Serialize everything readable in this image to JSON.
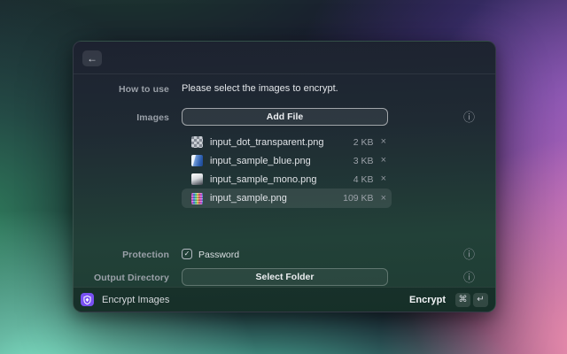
{
  "window": {
    "header": {
      "back_icon": "←"
    },
    "form": {
      "how_to_use": {
        "label": "How to use",
        "value": "Please select the images to encrypt."
      },
      "images": {
        "label": "Images",
        "add_file_label": "Add File",
        "files": [
          {
            "name": "input_dot_transparent.png",
            "size": "2 KB",
            "thumb": "checkerboard-transparent",
            "selected": false
          },
          {
            "name": "input_sample_blue.png",
            "size": "3 KB",
            "thumb": "blue-image",
            "selected": false
          },
          {
            "name": "input_sample_mono.png",
            "size": "4 KB",
            "thumb": "mono-gradient",
            "selected": false
          },
          {
            "name": "input_sample.png",
            "size": "109 KB",
            "thumb": "color-noise",
            "selected": true
          }
        ]
      },
      "protection": {
        "label": "Protection",
        "checkbox_label": "Password",
        "checked": true
      },
      "output_directory": {
        "label": "Output Directory",
        "button_label": "Select Folder"
      }
    },
    "footer": {
      "app_title": "Encrypt Images",
      "action_label": "Encrypt",
      "shortcut_keys": [
        "⌘",
        "↵"
      ]
    },
    "icons": {
      "remove": "×",
      "info": "ⓘ",
      "check": "✓"
    },
    "colors": {
      "app_icon_bg": "#7850f2",
      "mint": "#8bf3d4",
      "pink": "#ef8fae",
      "purple": "#cb70cf"
    }
  }
}
